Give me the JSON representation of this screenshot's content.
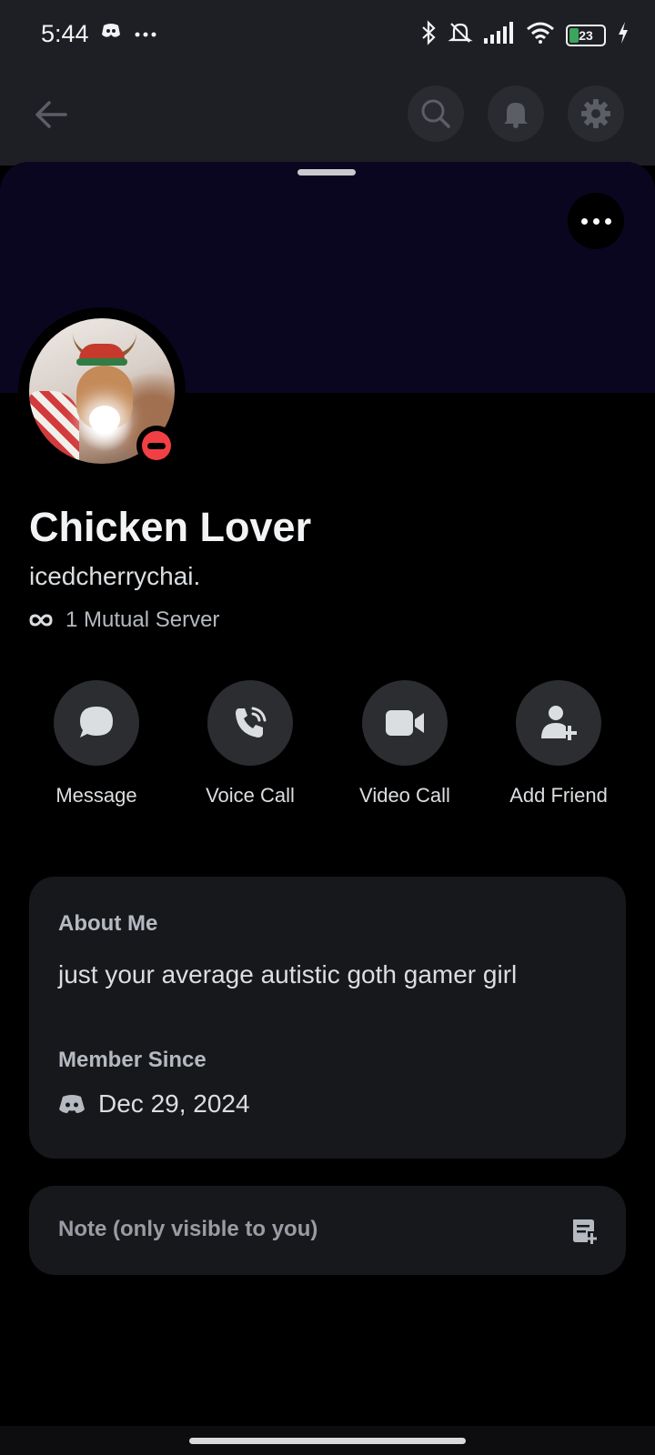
{
  "status_bar": {
    "time": "5:44",
    "battery_level": "23",
    "icons": [
      "discord-notification-icon",
      "more-icon",
      "bluetooth-icon",
      "bell-muted-icon",
      "signal-icon",
      "wifi-icon",
      "battery-icon",
      "charging-icon"
    ]
  },
  "nav": {
    "back": "back-arrow-icon",
    "search": "search-icon",
    "notifications": "bell-icon",
    "settings": "gear-icon"
  },
  "profile": {
    "display_name": "Chicken Lover",
    "username": "icedcherrychai.",
    "mutual_servers": "1 Mutual Server",
    "status": "do-not-disturb",
    "status_color": "#f23f43",
    "banner_color": "#0a0620"
  },
  "actions": [
    {
      "label": "Message",
      "icon": "chat-bubble-icon"
    },
    {
      "label": "Voice Call",
      "icon": "phone-icon"
    },
    {
      "label": "Video Call",
      "icon": "video-camera-icon"
    },
    {
      "label": "Add Friend",
      "icon": "add-friend-icon"
    }
  ],
  "about": {
    "heading": "About Me",
    "text": "just your average autistic goth gamer girl",
    "member_since_heading": "Member Since",
    "member_since_date": "Dec 29, 2024"
  },
  "note": {
    "placeholder": "Note (only visible to you)"
  }
}
